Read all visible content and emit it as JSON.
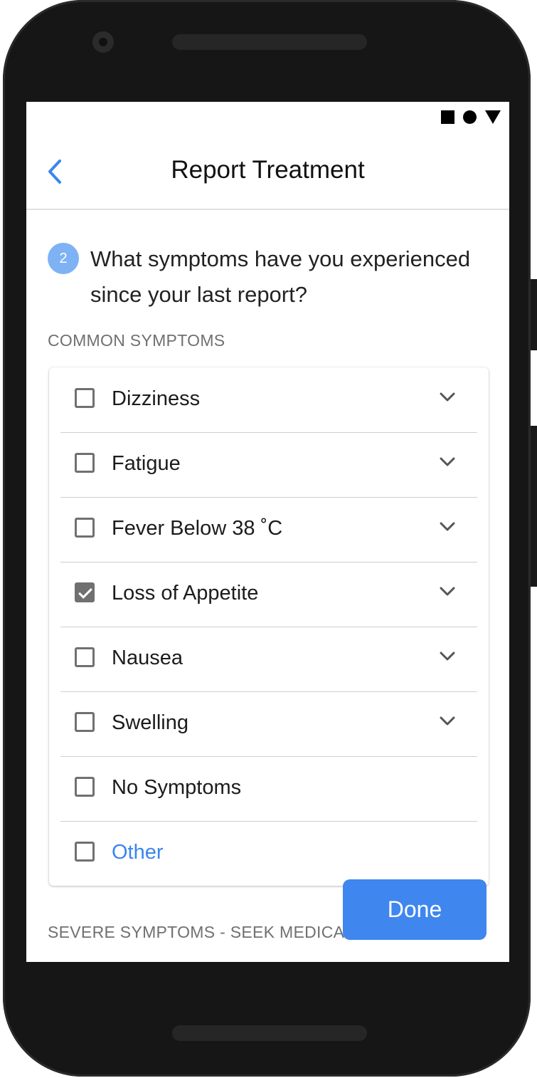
{
  "app_bar": {
    "title": "Report Treatment",
    "back_icon": "chevron-left-icon",
    "accent_color": "#3b86ed"
  },
  "status_bar": {
    "icons": [
      "square-icon",
      "circle-icon",
      "triangle-down-icon"
    ]
  },
  "question": {
    "step": "2",
    "text": "What symptoms have you experienced since your last report?"
  },
  "sections": {
    "common_label": "COMMON SYMPTOMS",
    "severe_label": "SEVERE SYMPTOMS - SEEK MEDICA"
  },
  "symptoms": [
    {
      "label": "Dizziness",
      "checked": false,
      "expandable": true
    },
    {
      "label": "Fatigue",
      "checked": false,
      "expandable": true
    },
    {
      "label": "Fever Below 38 ˚C",
      "checked": false,
      "expandable": true
    },
    {
      "label": "Loss of Appetite",
      "checked": true,
      "expandable": true
    },
    {
      "label": "Nausea",
      "checked": false,
      "expandable": true
    },
    {
      "label": "Swelling",
      "checked": false,
      "expandable": true
    },
    {
      "label": "No Symptoms",
      "checked": false,
      "expandable": false
    },
    {
      "label": "Other",
      "checked": false,
      "expandable": false
    }
  ],
  "actions": {
    "done_label": "Done",
    "done_color": "#3f86ef"
  }
}
